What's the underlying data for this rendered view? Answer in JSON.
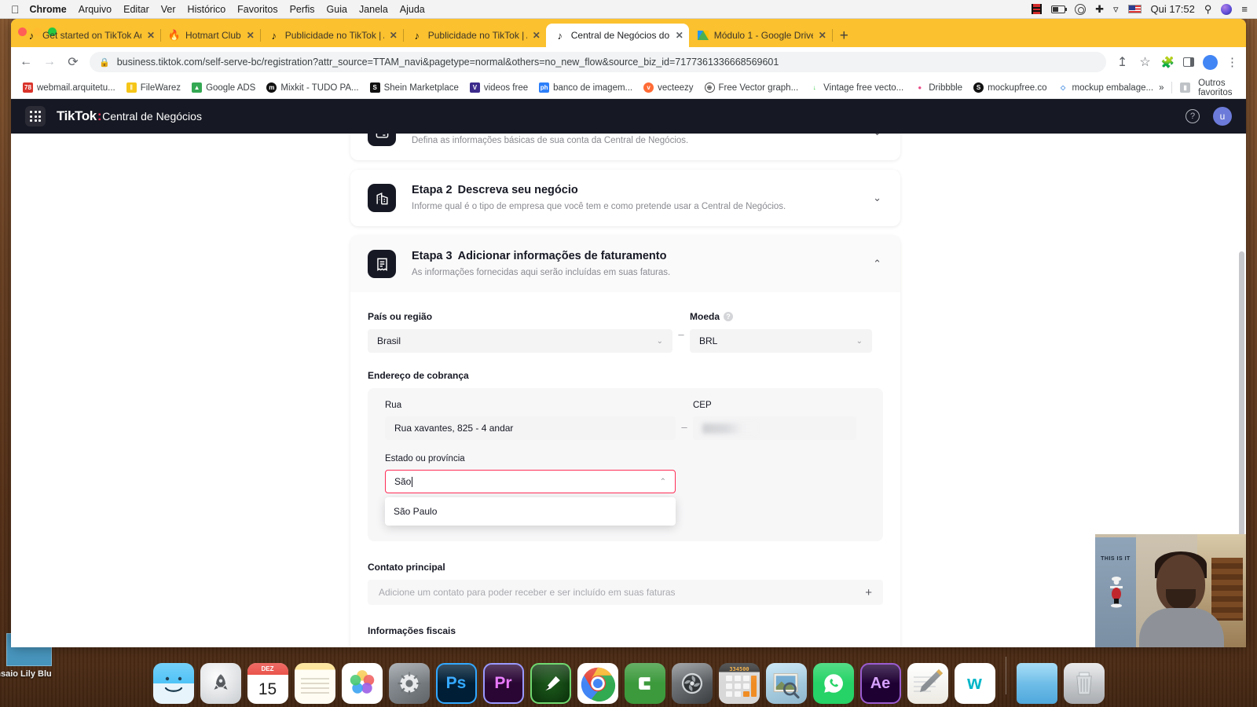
{
  "menubar": {
    "apple_icon": "apple-logo-icon",
    "items": [
      {
        "label": "Chrome",
        "bold": true
      },
      {
        "label": "Arquivo",
        "bold": false
      },
      {
        "label": "Editar",
        "bold": false
      },
      {
        "label": "Ver",
        "bold": false
      },
      {
        "label": "Histórico",
        "bold": false
      },
      {
        "label": "Favoritos",
        "bold": false
      },
      {
        "label": "Perfis",
        "bold": false
      },
      {
        "label": "Guia",
        "bold": false
      },
      {
        "label": "Janela",
        "bold": false
      },
      {
        "label": "Ajuda",
        "bold": false
      }
    ],
    "status": {
      "clock": "Qui 17:52",
      "icons": [
        "film-strip-icon",
        "battery-icon",
        "closed-caption-icon",
        "airdrop-icon",
        "wifi-icon",
        "us-flag-input-icon",
        "spotlight-search-icon",
        "siri-icon",
        "control-center-icon"
      ]
    }
  },
  "browser": {
    "tabs": [
      {
        "title": "Get started on TikTok Ads Man",
        "favicon": "tiktok-icon",
        "active": false
      },
      {
        "title": "Hotmart Club",
        "favicon": "hotmart-icon",
        "active": false
      },
      {
        "title": "Publicidade no TikTok | Anúnci",
        "favicon": "tiktok-icon",
        "active": false
      },
      {
        "title": "Publicidade no TikTok | Anúnci",
        "favicon": "tiktok-icon",
        "active": false
      },
      {
        "title": "Central de Negócios do TikTok",
        "favicon": "tiktok-icon",
        "active": true
      },
      {
        "title": "Módulo 1 - Google Drive",
        "favicon": "google-drive-icon",
        "active": false
      }
    ],
    "new_tab_glyph": "+",
    "toolbar": {
      "back_glyph": "←",
      "forward_glyph": "→",
      "reload_glyph": "⟳",
      "lock_glyph": "🔒",
      "url": "business.tiktok.com/self-serve-bc/registration?attr_source=TTAM_navi&pagetype=normal&others=no_new_flow&source_biz_id=7177361336668569601",
      "share_glyph": "↥",
      "star_glyph": "☆",
      "extensions_glyph": "🧩",
      "avatar_initial": "",
      "menu_glyph": "⋮"
    },
    "bookmarks": [
      {
        "label": "webmail.arquitetu...",
        "icon_text": "78",
        "icon_color": "#d9342b"
      },
      {
        "label": "FileWarez",
        "icon_text": "𝄃",
        "icon_color": "#f5c518"
      },
      {
        "label": "Google ADS",
        "icon_text": "▲",
        "icon_color": "#34a853"
      },
      {
        "label": "Mixkit - TUDO PA...",
        "icon_text": "m",
        "icon_color": "#111111"
      },
      {
        "label": "Shein Marketplace",
        "icon_text": "S",
        "icon_color": "#111111"
      },
      {
        "label": "videos free",
        "icon_text": "V",
        "icon_color": "#3d2b8c"
      },
      {
        "label": "banco de imagem...",
        "icon_text": "ph",
        "icon_color": "#2d7ff9"
      },
      {
        "label": "vecteezy",
        "icon_text": "v",
        "icon_color": "#ff6b35"
      },
      {
        "label": "Free Vector graph...",
        "icon_text": "⊕",
        "icon_color": "#4a4a4a"
      },
      {
        "label": "Vintage free vecto...",
        "icon_text": "↓",
        "icon_color": "#2ecc40"
      },
      {
        "label": "Dribbble",
        "icon_text": "●",
        "icon_color": "#ea4c89"
      },
      {
        "label": "mockupfree.co",
        "icon_text": "S",
        "icon_color": "#111111"
      },
      {
        "label": "mockup embalage...",
        "icon_text": "◇",
        "icon_color": "#4a90e2"
      }
    ],
    "bookmarks_overflow_glyph": "»",
    "other_bookmarks_label": "Outros favoritos",
    "other_bookmarks_icon": "folder-icon"
  },
  "tiktok": {
    "header": {
      "grid_icon": "app-grid-icon",
      "logo": "TikTok",
      "logo_colon": ":",
      "subtitle": "Central de Negócios",
      "help_glyph": "?",
      "avatar_initial": "u"
    },
    "steps": [
      {
        "icon": "account-info-icon",
        "num": "",
        "title": "",
        "desc": "Defina as informações básicas de sua conta da Central de Negócios.",
        "chevron": "⌄",
        "expanded": false
      },
      {
        "icon": "business-building-icon",
        "num": "Etapa 2",
        "title": "Descreva seu negócio",
        "desc": "Informe qual é o tipo de empresa que você tem e como pretende usar a Central de Negócios.",
        "chevron": "⌄",
        "expanded": false
      },
      {
        "icon": "invoice-receipt-icon",
        "num": "Etapa 3",
        "title": "Adicionar informações de faturamento",
        "desc": "As informações fornecidas aqui serão incluídas em suas faturas.",
        "chevron": "⌃",
        "expanded": true
      }
    ],
    "billing_form": {
      "country_label": "País ou região",
      "country_value": "Brasil",
      "currency_label": "Moeda",
      "currency_value": "BRL",
      "currency_tooltip_glyph": "?",
      "separator": "–",
      "caret_glyph": "⌄",
      "address_section_label": "Endereço de cobrança",
      "street_label": "Rua",
      "street_value": "Rua xavantes, 825 - 4 andar",
      "zip_label": "CEP",
      "zip_value": "",
      "zip_redacted": true,
      "state_label": "Estado ou província",
      "state_value": "São",
      "state_caret_glyph": "⌃",
      "state_options": [
        "São Paulo"
      ],
      "contact_label": "Contato principal",
      "contact_placeholder": "Adicione um contato para poder receber e ser incluído em suas faturas",
      "contact_add_glyph": "+",
      "tax_section_label": "Informações fiscais"
    },
    "accent_color": "#fe2c55",
    "header_bg": "#161823"
  },
  "desktop": {
    "file_label": "nsaio Lily Blu",
    "dock": [
      {
        "name": "finder",
        "glyph": ""
      },
      {
        "name": "launchpad",
        "glyph": "🚀"
      },
      {
        "name": "calendar",
        "glyph": "",
        "month": "DEZ",
        "day": "15"
      },
      {
        "name": "notes",
        "glyph": ""
      },
      {
        "name": "photos",
        "glyph": ""
      },
      {
        "name": "system-preferences",
        "glyph": "⚙"
      },
      {
        "name": "photoshop",
        "glyph": "Ps"
      },
      {
        "name": "premiere-pro",
        "glyph": "Pr"
      },
      {
        "name": "sketch-pen",
        "glyph": "✎"
      },
      {
        "name": "google-chrome",
        "glyph": ""
      },
      {
        "name": "camtasia",
        "glyph": "C"
      },
      {
        "name": "fan-utility",
        "glyph": "✷"
      },
      {
        "name": "calculator",
        "glyph": ""
      },
      {
        "name": "preview",
        "glyph": ""
      },
      {
        "name": "whatsapp",
        "glyph": "✆"
      },
      {
        "name": "after-effects",
        "glyph": "Ae"
      },
      {
        "name": "textedit",
        "glyph": ""
      },
      {
        "name": "w-app",
        "glyph": "w"
      },
      {
        "name": "downloads-folder",
        "glyph": ""
      },
      {
        "name": "trash",
        "glyph": ""
      }
    ]
  },
  "webcam": {
    "poster_text": "THIS IS IT",
    "present": true
  }
}
